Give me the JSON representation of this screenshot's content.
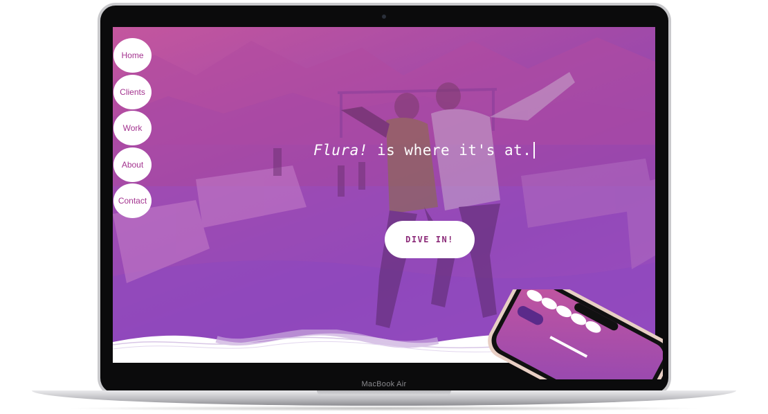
{
  "device": {
    "label": "MacBook Air"
  },
  "nav": {
    "items": [
      {
        "label": "Home"
      },
      {
        "label": "Clients"
      },
      {
        "label": "Work"
      },
      {
        "label": "About"
      },
      {
        "label": "Contact"
      }
    ]
  },
  "hero": {
    "brand": "Flura!",
    "tagline": " is where it's at.",
    "cta_label": "DIVE IN!"
  },
  "colors": {
    "accent": "#a3338f",
    "gradient_top": "#c4569e",
    "gradient_bottom": "#8a45b6"
  }
}
